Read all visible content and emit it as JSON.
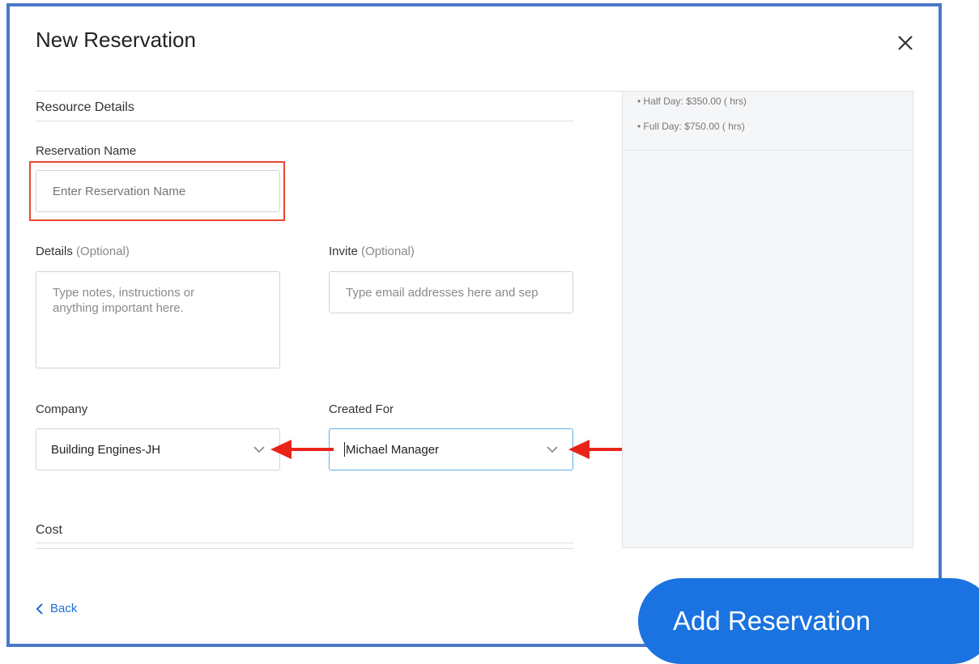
{
  "dialog": {
    "title": "New Reservation",
    "close_icon": "close-icon"
  },
  "resource_details": {
    "heading": "Resource Details"
  },
  "reservation_name": {
    "label": "Reservation Name",
    "placeholder": "Enter Reservation Name",
    "value": ""
  },
  "details": {
    "label": "Details",
    "optional": "(Optional)",
    "placeholder": "Type notes, instructions or anything important here."
  },
  "invite": {
    "label": "Invite",
    "optional": "(Optional)",
    "placeholder": "Type email addresses here and sep"
  },
  "company": {
    "label": "Company",
    "selected": "Building Engines-JH"
  },
  "created_for": {
    "label": "Created For",
    "selected": "Michael Manager"
  },
  "cost": {
    "heading": "Cost"
  },
  "pricing": [
    "• Half Day: $350.00 ( hrs)",
    "• Full Day: $750.00 ( hrs)"
  ],
  "footer": {
    "back_label": "Back",
    "add_label": "Add Reservation"
  },
  "colors": {
    "accent": "#1a73e0",
    "frame": "#4a78c8",
    "annotation": "#e8472f"
  }
}
